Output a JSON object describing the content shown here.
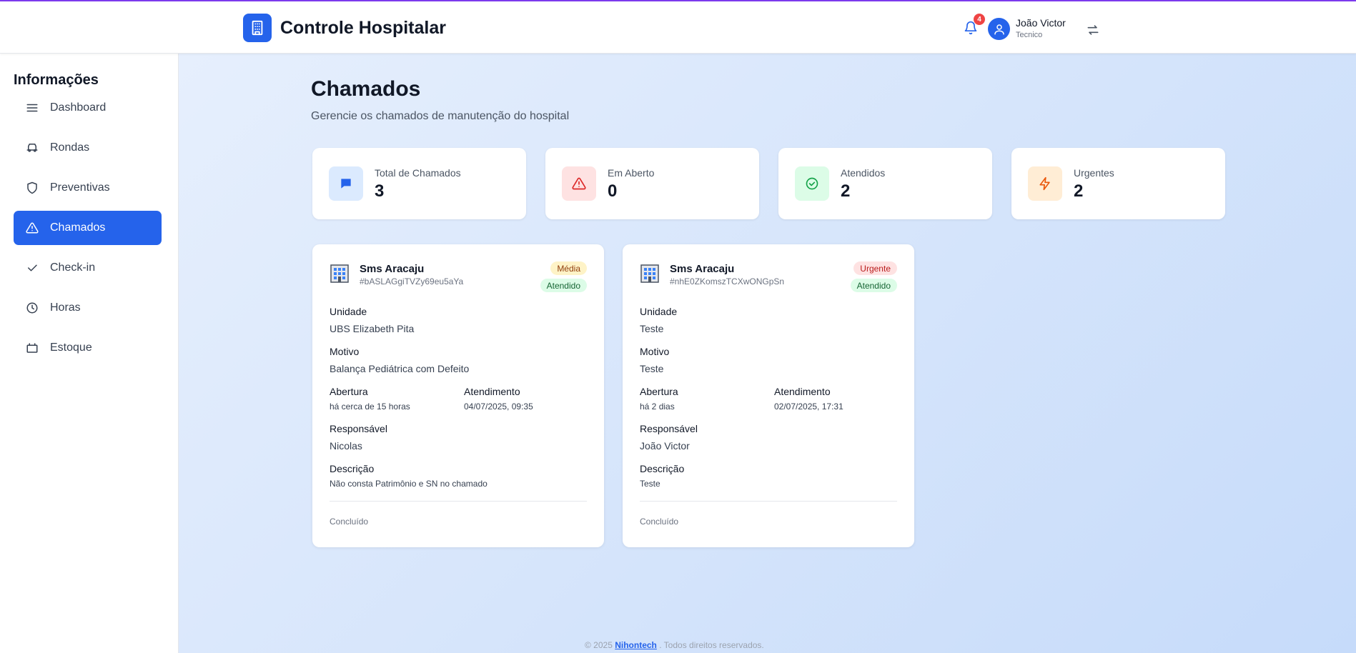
{
  "header": {
    "app_title": "Controle Hospitalar",
    "notification_count": "4",
    "user_name": "João Victor",
    "user_role": "Tecnico"
  },
  "sidebar": {
    "title": "Informações",
    "items": [
      {
        "label": "Dashboard",
        "icon": "menu-icon"
      },
      {
        "label": "Rondas",
        "icon": "vehicle-icon"
      },
      {
        "label": "Preventivas",
        "icon": "shield-icon"
      },
      {
        "label": "Chamados",
        "icon": "alert-triangle-icon",
        "active": true
      },
      {
        "label": "Check-in",
        "icon": "check-icon"
      },
      {
        "label": "Horas",
        "icon": "clock-icon"
      },
      {
        "label": "Estoque",
        "icon": "box-icon"
      }
    ]
  },
  "page": {
    "title": "Chamados",
    "subtitle": "Gerencie os chamados de manutenção do hospital"
  },
  "stats": [
    {
      "label": "Total de Chamados",
      "value": "3",
      "icon": "message-icon",
      "color": "#2563eb",
      "bg": "#dbeafe"
    },
    {
      "label": "Em Aberto",
      "value": "0",
      "icon": "alert-triangle-icon",
      "color": "#dc2626",
      "bg": "#fee2e2"
    },
    {
      "label": "Atendidos",
      "value": "2",
      "icon": "check-circle-icon",
      "color": "#16a34a",
      "bg": "#dcfce7"
    },
    {
      "label": "Urgentes",
      "value": "2",
      "icon": "zap-icon",
      "color": "#ea580c",
      "bg": "#ffedd5"
    }
  ],
  "tickets": [
    {
      "title": "Sms Aracaju",
      "id": "#bASLAGgiTVZy69eu5aYa",
      "priority": "Média",
      "status": "Atendido",
      "unidade_label": "Unidade",
      "unidade": "UBS Elizabeth Pita",
      "motivo_label": "Motivo",
      "motivo": "Balança Pediátrica com Defeito",
      "abertura_label": "Abertura",
      "abertura": "há cerca de 15 horas",
      "atendimento_label": "Atendimento",
      "atendimento": "04/07/2025, 09:35",
      "responsavel_label": "Responsável",
      "responsavel": "Nicolas",
      "descricao_label": "Descrição",
      "descricao": "Não consta Patrimônio e SN no chamado",
      "footer": "Concluído"
    },
    {
      "title": "Sms Aracaju",
      "id": "#nhE0ZKomszTCXwONGpSn",
      "priority": "Urgente",
      "status": "Atendido",
      "unidade_label": "Unidade",
      "unidade": "Teste",
      "motivo_label": "Motivo",
      "motivo": "Teste",
      "abertura_label": "Abertura",
      "abertura": "há 2 dias",
      "atendimento_label": "Atendimento",
      "atendimento": "02/07/2025, 17:31",
      "responsavel_label": "Responsável",
      "responsavel": "João Victor",
      "descricao_label": "Descrição",
      "descricao": "Teste",
      "footer": "Concluído"
    }
  ],
  "footer": {
    "copyright": "© 2025",
    "company": "Nihontech",
    "rights": ". Todos direitos reservados."
  },
  "colors": {
    "primary": "#2563eb",
    "topbar_accent": "#7c3aed"
  }
}
